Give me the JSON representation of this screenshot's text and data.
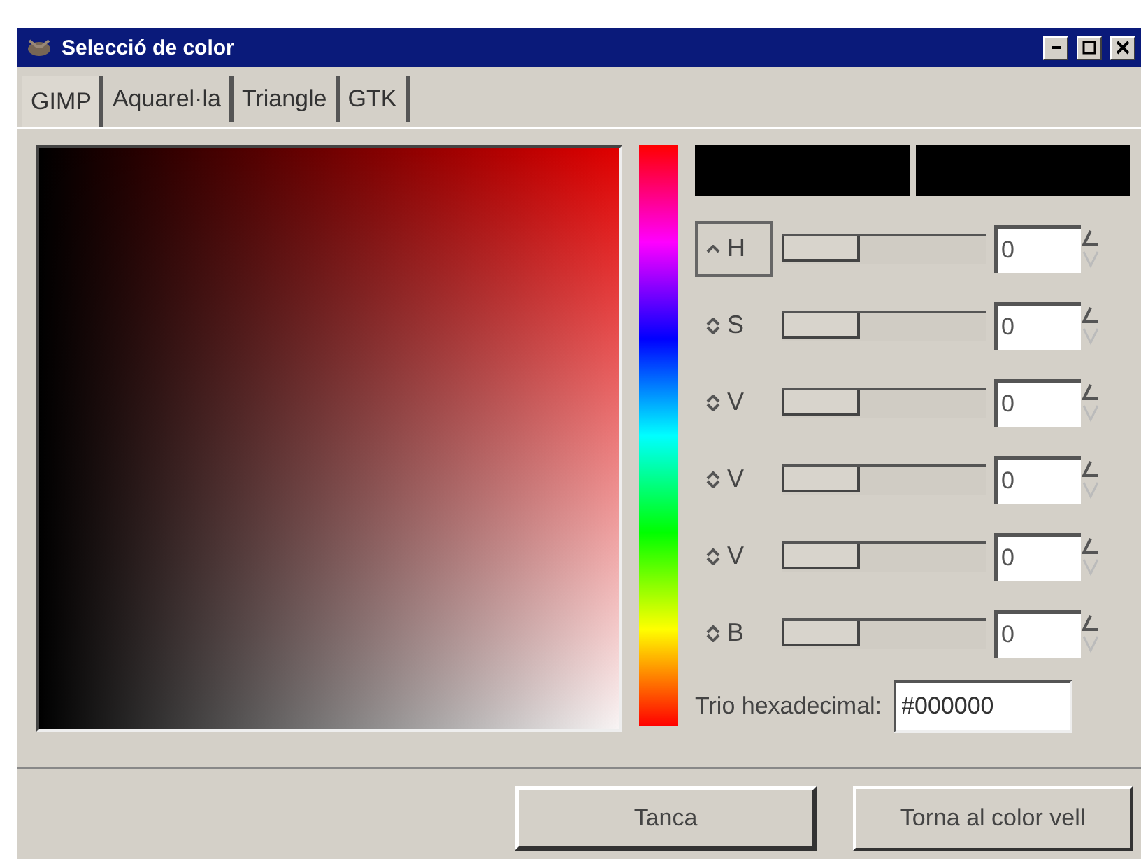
{
  "window": {
    "title": "Selecció de color"
  },
  "tabs": [
    {
      "label": "GIMP",
      "selected": true
    },
    {
      "label": "Aquarel·la",
      "selected": false
    },
    {
      "label": "Triangle",
      "selected": false
    },
    {
      "label": "GTK",
      "selected": false
    }
  ],
  "swatches": [
    {
      "color": "#000000"
    },
    {
      "color": "#000000"
    }
  ],
  "channels": [
    {
      "label": "H",
      "selected": true,
      "level": 0,
      "value": "0"
    },
    {
      "label": "S",
      "selected": false,
      "level": 0,
      "value": "0"
    },
    {
      "label": "V",
      "selected": false,
      "level": 0,
      "value": "0"
    },
    {
      "label": "V",
      "selected": false,
      "level": 0,
      "value": "0"
    },
    {
      "label": "V",
      "selected": false,
      "level": 0,
      "value": "0"
    },
    {
      "label": "B",
      "selected": false,
      "level": 0,
      "value": "0"
    }
  ],
  "hex": {
    "label": "Trio hexadecimal:",
    "value": "#000000"
  },
  "buttons": [
    {
      "label": "Tanca",
      "default": true
    },
    {
      "label": "Torna al color vell",
      "default": false
    }
  ]
}
